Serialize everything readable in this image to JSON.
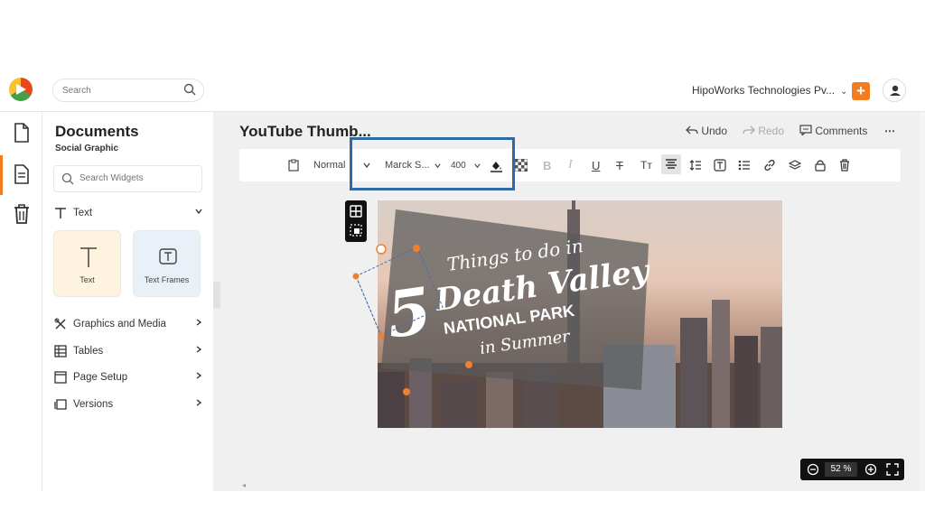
{
  "topbar": {
    "search_placeholder": "Search",
    "org_name": "HipoWorks Technologies Pv...",
    "org_chevron": "⌄",
    "plus_label": "+"
  },
  "rail": {
    "items": [
      "file-icon",
      "document-icon",
      "trash-icon"
    ]
  },
  "panel": {
    "title": "Documents",
    "subtitle": "Social Graphic",
    "search_placeholder": "Search Widgets",
    "sections": {
      "text": "Text",
      "graphics": "Graphics and Media",
      "tables": "Tables",
      "page_setup": "Page Setup",
      "versions": "Versions"
    },
    "cards": {
      "text": "Text",
      "text_frames": "Text Frames"
    }
  },
  "header": {
    "doc_title": "YouTube Thumb...",
    "undo": "Undo",
    "redo": "Redo",
    "comments": "Comments",
    "more": "⋯"
  },
  "toolbar": {
    "style": "Normal",
    "font": "Marck S...",
    "weight": "400",
    "italic": "I",
    "bold": "B",
    "underline": "U",
    "strike": "T",
    "textcase": "Tт"
  },
  "banner": {
    "line1": "Things to do in",
    "number": "5",
    "line2": "Death Valley",
    "line3": "NATIONAL PARK",
    "line4": "in Summer"
  },
  "zoom": {
    "value": "52",
    "unit": "%"
  },
  "colors": {
    "accent": "#f47c20",
    "highlight": "#2f6aa3",
    "overlay": "#5a5a5a"
  }
}
